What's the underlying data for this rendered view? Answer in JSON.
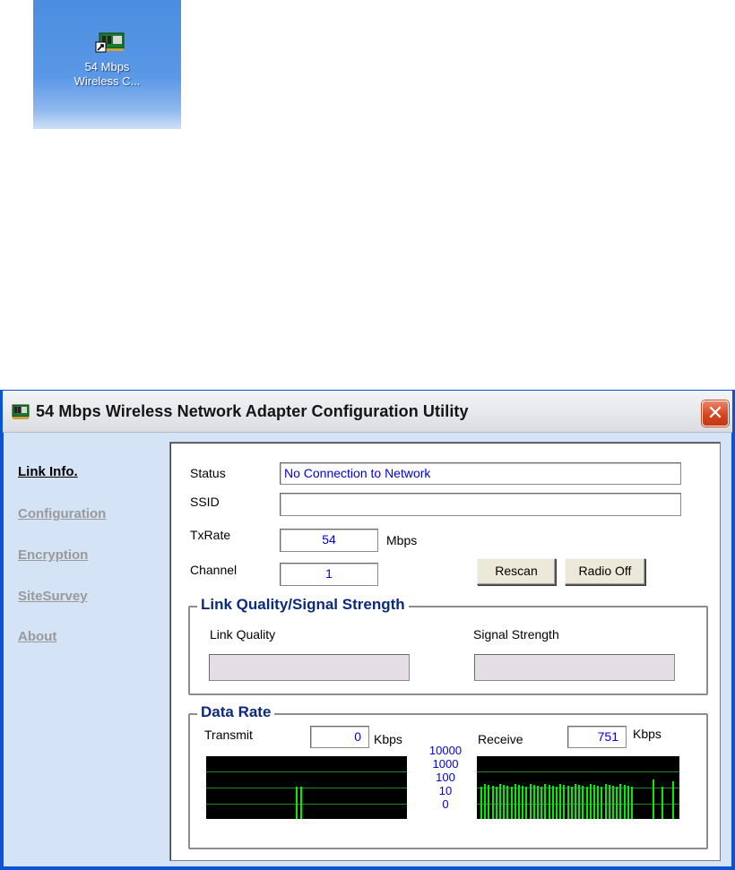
{
  "desktop": {
    "icon_name": "network-card-icon",
    "label_line1": "54 Mbps",
    "label_line2": "Wireless C..."
  },
  "window": {
    "title": "54 Mbps Wireless Network Adapter Configuration Utility",
    "close_glyph": "✕"
  },
  "nav": {
    "items": [
      {
        "label": "Link Info.",
        "active": true
      },
      {
        "label": "Configuration",
        "active": false
      },
      {
        "label": "Encryption",
        "active": false
      },
      {
        "label": "SiteSurvey",
        "active": false
      },
      {
        "label": "About",
        "active": false
      }
    ]
  },
  "link_info": {
    "status_label": "Status",
    "status_value": "No Connection to Network",
    "ssid_label": "SSID",
    "ssid_value": "",
    "txrate_label": "TxRate",
    "txrate_value": "54",
    "txrate_unit": "Mbps",
    "channel_label": "Channel",
    "channel_value": "1",
    "rescan_label": "Rescan",
    "radio_off_label": "Radio Off"
  },
  "quality": {
    "title": "Link Quality/Signal Strength",
    "link_quality_label": "Link Quality",
    "signal_strength_label": "Signal Strength"
  },
  "data_rate": {
    "title": "Data Rate",
    "transmit_label": "Transmit",
    "transmit_value": "0",
    "transmit_unit": "Kbps",
    "receive_label": "Receive",
    "receive_value": "751",
    "receive_unit": "Kbps",
    "scale": [
      "10000",
      "1000",
      "100",
      "10",
      "0"
    ]
  },
  "colors": {
    "graph_bg": "#000000",
    "graph_bar": "#00ee00",
    "value_text": "#0000e0",
    "group_title": "#0b2a7c"
  }
}
